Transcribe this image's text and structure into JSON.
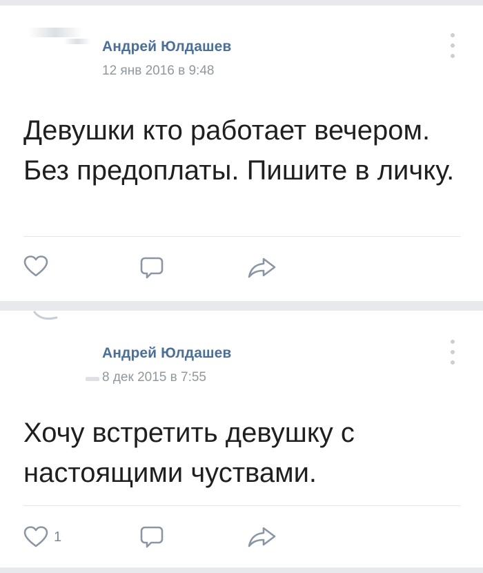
{
  "posts": [
    {
      "author": "Андрей Юлдашев",
      "date": "12 янв 2016 в 9:48",
      "text": "Девушки кто работает вечером. Без предоплаты. Пишите в личку.",
      "likes": ""
    },
    {
      "author": "Андрей Юлдашев",
      "date": "8 дек 2015 в 7:55",
      "text": "Хочу встретить девушку с настоящими чуствами.",
      "likes": "1"
    }
  ],
  "icons": {
    "like": "heart-outline-icon",
    "comment": "comment-bubble-icon",
    "share": "share-arrow-icon",
    "menu": "vertical-dots-icon"
  },
  "colors": {
    "author": "#4a6f98",
    "date": "#8f979f",
    "text": "#1f1f1f",
    "icon": "#8a96a3",
    "background": "#e7e9ec"
  }
}
